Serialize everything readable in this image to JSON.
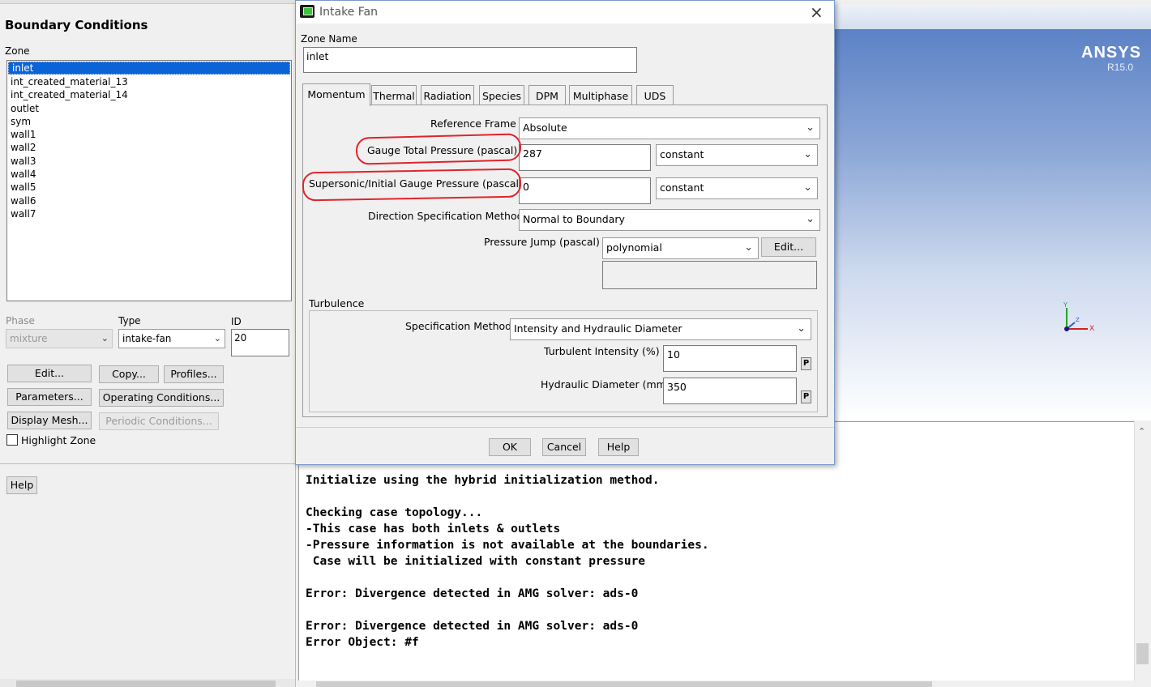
{
  "boundary_panel": {
    "title": "Boundary Conditions",
    "zone_label": "Zone",
    "zones": [
      "inlet",
      "int_created_material_13",
      "int_created_material_14",
      "outlet",
      "sym",
      "wall1",
      "wall2",
      "wall3",
      "wall4",
      "wall5",
      "wall6",
      "wall7"
    ],
    "selected_zone": "inlet",
    "phase_label": "Phase",
    "phase_value": "mixture",
    "type_label": "Type",
    "type_value": "intake-fan",
    "id_label": "ID",
    "id_value": "20",
    "buttons": {
      "edit": "Edit...",
      "copy": "Copy...",
      "profiles": "Profiles...",
      "parameters": "Parameters...",
      "operating_conditions": "Operating Conditions...",
      "display_mesh": "Display Mesh...",
      "periodic_conditions": "Periodic Conditions..."
    },
    "highlight_zone_label": "Highlight Zone",
    "help": "Help"
  },
  "dialog": {
    "title": "Intake Fan",
    "zone_name_label": "Zone Name",
    "zone_name_value": "inlet",
    "tabs": [
      "Momentum",
      "Thermal",
      "Radiation",
      "Species",
      "DPM",
      "Multiphase",
      "UDS"
    ],
    "active_tab": "Momentum",
    "momentum": {
      "reference_frame_label": "Reference Frame",
      "reference_frame_value": "Absolute",
      "gauge_total_pressure_label": "Gauge Total Pressure (pascal)",
      "gauge_total_pressure_value": "287",
      "gauge_total_pressure_method": "constant",
      "supersonic_pressure_label": "Supersonic/Initial Gauge Pressure (pascal)",
      "supersonic_pressure_value": "0",
      "supersonic_pressure_method": "constant",
      "direction_label": "Direction Specification Method",
      "direction_value": "Normal to Boundary",
      "pressure_jump_label": "Pressure Jump (pascal)",
      "pressure_jump_value": "polynomial",
      "pressure_jump_edit": "Edit..."
    },
    "turbulence": {
      "group_label": "Turbulence",
      "spec_method_label": "Specification Method",
      "spec_method_value": "Intensity and Hydraulic Diameter",
      "intensity_label": "Turbulent Intensity (%)",
      "intensity_value": "10",
      "hydraulic_diameter_label": "Hydraulic Diameter (mm)",
      "hydraulic_diameter_value": "350",
      "param_button": "P"
    },
    "buttons": {
      "ok": "OK",
      "cancel": "Cancel",
      "help": "Help"
    }
  },
  "graphics": {
    "brand": "ANSYS",
    "version": "R15.0",
    "triad_axes": [
      "Y",
      "Z",
      "X"
    ]
  },
  "console": {
    "lines": [
      "Initialize using the hybrid initialization method.",
      "",
      "Checking case topology...",
      "-This case has both inlets & outlets",
      "-Pressure information is not available at the boundaries.",
      " Case will be initialized with constant pressure",
      "",
      "Error: Divergence detected in AMG solver: ads-0",
      "",
      "Error: Divergence detected in AMG solver: ads-0",
      "Error Object: #f"
    ]
  },
  "annotations": {
    "color": "#e0242b"
  },
  "colors": {
    "selection": "#0a64d8",
    "graphics_top": "#5c82c6"
  }
}
